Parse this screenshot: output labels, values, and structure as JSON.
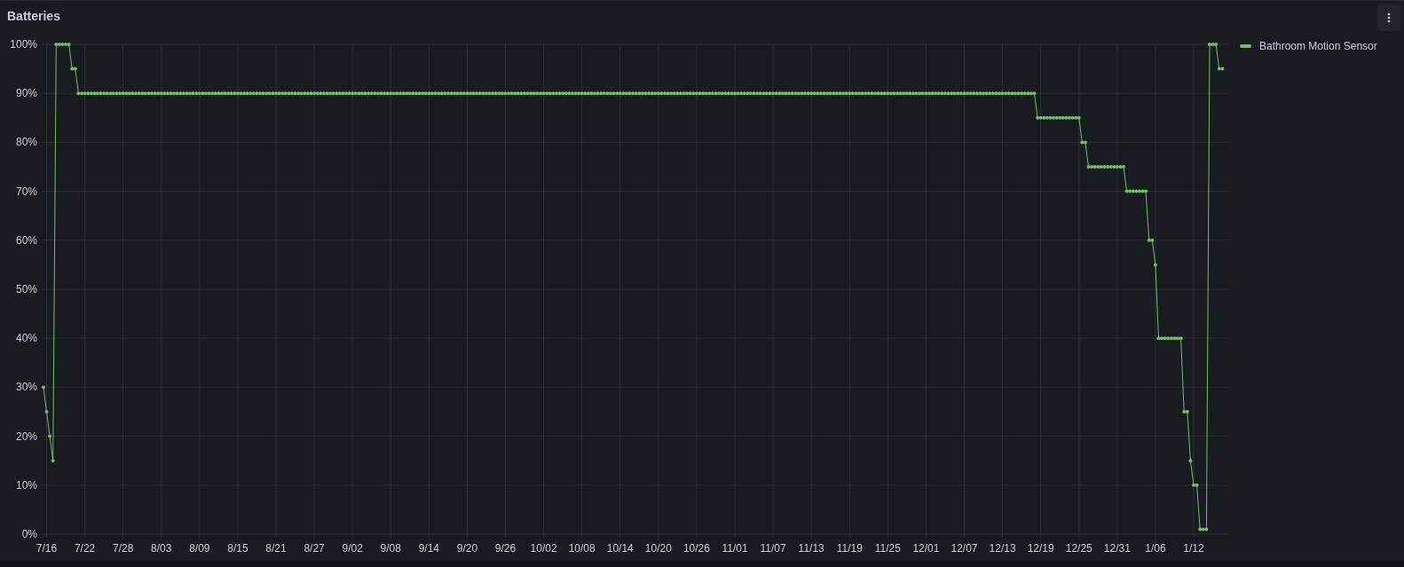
{
  "panel": {
    "title": "Batteries"
  },
  "chart_data": {
    "type": "line",
    "grid": true,
    "ylim": [
      0,
      100
    ],
    "yticks": [
      {
        "value": 0,
        "label": "0%"
      },
      {
        "value": 10,
        "label": "10%"
      },
      {
        "value": 20,
        "label": "20%"
      },
      {
        "value": 30,
        "label": "30%"
      },
      {
        "value": 40,
        "label": "40%"
      },
      {
        "value": 50,
        "label": "50%"
      },
      {
        "value": 60,
        "label": "60%"
      },
      {
        "value": 70,
        "label": "70%"
      },
      {
        "value": 80,
        "label": "80%"
      },
      {
        "value": 90,
        "label": "90%"
      },
      {
        "value": 100,
        "label": "100%"
      }
    ],
    "categories": [
      null,
      null,
      "7/16",
      null,
      null,
      null,
      null,
      null,
      null,
      null,
      null,
      null,
      null,
      null,
      "7/22",
      null,
      null,
      null,
      null,
      null,
      null,
      null,
      null,
      null,
      null,
      null,
      "7/28",
      null,
      null,
      null,
      null,
      null,
      null,
      null,
      null,
      null,
      null,
      null,
      "8/03",
      null,
      null,
      null,
      null,
      null,
      null,
      null,
      null,
      null,
      null,
      null,
      "8/09",
      null,
      null,
      null,
      null,
      null,
      null,
      null,
      null,
      null,
      null,
      null,
      "8/15",
      null,
      null,
      null,
      null,
      null,
      null,
      null,
      null,
      null,
      null,
      null,
      "8/21",
      null,
      null,
      null,
      null,
      null,
      null,
      null,
      null,
      null,
      null,
      null,
      "8/27",
      null,
      null,
      null,
      null,
      null,
      null,
      null,
      null,
      null,
      null,
      null,
      "9/02",
      null,
      null,
      null,
      null,
      null,
      null,
      null,
      null,
      null,
      null,
      null,
      "9/08",
      null,
      null,
      null,
      null,
      null,
      null,
      null,
      null,
      null,
      null,
      null,
      "9/14",
      null,
      null,
      null,
      null,
      null,
      null,
      null,
      null,
      null,
      null,
      null,
      "9/20",
      null,
      null,
      null,
      null,
      null,
      null,
      null,
      null,
      null,
      null,
      null,
      "9/26",
      null,
      null,
      null,
      null,
      null,
      null,
      null,
      null,
      null,
      null,
      null,
      "10/02",
      null,
      null,
      null,
      null,
      null,
      null,
      null,
      null,
      null,
      null,
      null,
      "10/08",
      null,
      null,
      null,
      null,
      null,
      null,
      null,
      null,
      null,
      null,
      null,
      "10/14",
      null,
      null,
      null,
      null,
      null,
      null,
      null,
      null,
      null,
      null,
      null,
      "10/20",
      null,
      null,
      null,
      null,
      null,
      null,
      null,
      null,
      null,
      null,
      null,
      "10/26",
      null,
      null,
      null,
      null,
      null,
      null,
      null,
      null,
      null,
      null,
      null,
      "11/01",
      null,
      null,
      null,
      null,
      null,
      null,
      null,
      null,
      null,
      null,
      null,
      "11/07",
      null,
      null,
      null,
      null,
      null,
      null,
      null,
      null,
      null,
      null,
      null,
      "11/13",
      null,
      null,
      null,
      null,
      null,
      null,
      null,
      null,
      null,
      null,
      null,
      "11/19",
      null,
      null,
      null,
      null,
      null,
      null,
      null,
      null,
      null,
      null,
      null,
      "11/25",
      null,
      null,
      null,
      null,
      null,
      null,
      null,
      null,
      null,
      null,
      null,
      "12/01",
      null,
      null,
      null,
      null,
      null,
      null,
      null,
      null,
      null,
      null,
      null,
      "12/07",
      null,
      null,
      null,
      null,
      null,
      null,
      null,
      null,
      null,
      null,
      null,
      "12/13",
      null,
      null,
      null,
      null,
      null,
      null,
      null,
      null,
      null,
      null,
      null,
      "12/19",
      null,
      null,
      null,
      null,
      null,
      null,
      null,
      null,
      null,
      null,
      null,
      "12/25",
      null,
      null,
      null,
      null,
      null,
      null,
      null,
      null,
      null,
      null,
      null,
      "12/31",
      null,
      null,
      null,
      null,
      null,
      null,
      null,
      null,
      null,
      null,
      null,
      "1/06",
      null,
      null,
      null,
      null,
      null,
      null,
      null,
      null,
      null,
      null,
      null,
      "1/12",
      null,
      null,
      null,
      null,
      null,
      null,
      null,
      null,
      null,
      null,
      null
    ],
    "series": [
      {
        "name": "Bathroom Motion Sensor",
        "color": "#73bf69",
        "values": [
          null,
          30,
          25,
          20,
          15,
          100,
          100,
          100,
          100,
          100,
          95,
          95,
          90,
          90,
          90,
          90,
          90,
          90,
          90,
          90,
          90,
          90,
          90,
          90,
          90,
          90,
          90,
          90,
          90,
          90,
          90,
          90,
          90,
          90,
          90,
          90,
          90,
          90,
          90,
          90,
          90,
          90,
          90,
          90,
          90,
          90,
          90,
          90,
          90,
          90,
          90,
          90,
          90,
          90,
          90,
          90,
          90,
          90,
          90,
          90,
          90,
          90,
          90,
          90,
          90,
          90,
          90,
          90,
          90,
          90,
          90,
          90,
          90,
          90,
          90,
          90,
          90,
          90,
          90,
          90,
          90,
          90,
          90,
          90,
          90,
          90,
          90,
          90,
          90,
          90,
          90,
          90,
          90,
          90,
          90,
          90,
          90,
          90,
          90,
          90,
          90,
          90,
          90,
          90,
          90,
          90,
          90,
          90,
          90,
          90,
          90,
          90,
          90,
          90,
          90,
          90,
          90,
          90,
          90,
          90,
          90,
          90,
          90,
          90,
          90,
          90,
          90,
          90,
          90,
          90,
          90,
          90,
          90,
          90,
          90,
          90,
          90,
          90,
          90,
          90,
          90,
          90,
          90,
          90,
          90,
          90,
          90,
          90,
          90,
          90,
          90,
          90,
          90,
          90,
          90,
          90,
          90,
          90,
          90,
          90,
          90,
          90,
          90,
          90,
          90,
          90,
          90,
          90,
          90,
          90,
          90,
          90,
          90,
          90,
          90,
          90,
          90,
          90,
          90,
          90,
          90,
          90,
          90,
          90,
          90,
          90,
          90,
          90,
          90,
          90,
          90,
          90,
          90,
          90,
          90,
          90,
          90,
          90,
          90,
          90,
          90,
          90,
          90,
          90,
          90,
          90,
          90,
          90,
          90,
          90,
          90,
          90,
          90,
          90,
          90,
          90,
          90,
          90,
          90,
          90,
          90,
          90,
          90,
          90,
          90,
          90,
          90,
          90,
          90,
          90,
          90,
          90,
          90,
          90,
          90,
          90,
          90,
          90,
          90,
          90,
          90,
          90,
          90,
          90,
          90,
          90,
          90,
          90,
          90,
          90,
          90,
          90,
          90,
          90,
          90,
          90,
          90,
          90,
          90,
          90,
          90,
          90,
          90,
          90,
          90,
          90,
          90,
          90,
          90,
          90,
          90,
          90,
          90,
          90,
          90,
          90,
          90,
          90,
          90,
          90,
          90,
          90,
          90,
          90,
          90,
          90,
          90,
          90,
          90,
          90,
          90,
          90,
          90,
          90,
          90,
          90,
          90,
          90,
          90,
          90,
          90,
          90,
          90,
          90,
          90,
          90,
          90,
          90,
          90,
          90,
          90,
          90,
          90,
          85,
          85,
          85,
          85,
          85,
          85,
          85,
          85,
          85,
          85,
          85,
          85,
          85,
          85,
          80,
          80,
          75,
          75,
          75,
          75,
          75,
          75,
          75,
          75,
          75,
          75,
          75,
          75,
          70,
          70,
          70,
          70,
          70,
          70,
          70,
          60,
          60,
          55,
          40,
          40,
          40,
          40,
          40,
          40,
          40,
          40,
          25,
          25,
          15,
          10,
          10,
          1,
          1,
          1,
          100,
          100,
          100,
          95,
          95,
          null,
          null
        ]
      }
    ]
  }
}
